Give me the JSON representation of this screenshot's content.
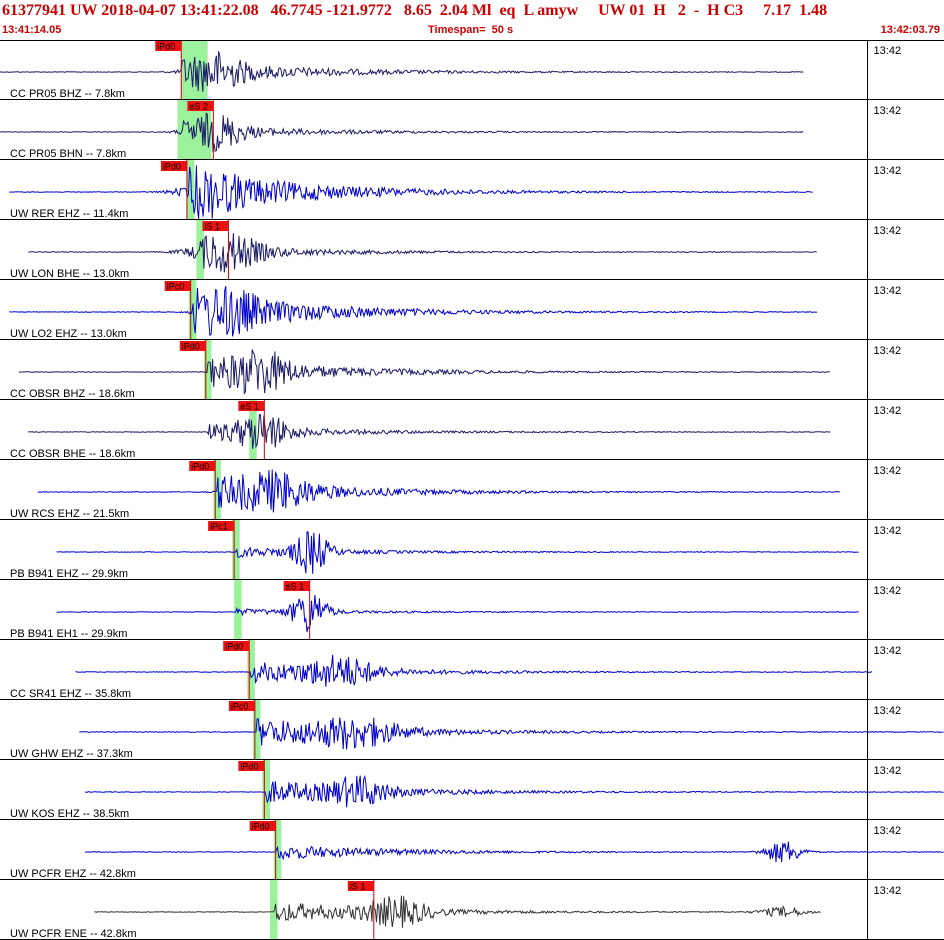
{
  "header": {
    "title": "61377941 UW 2018-04-07 13:41:22.08   46.7745 -121.9772   8.65  2.04 Ml  eq  L amyw     UW 01  H   2  -  H C3     7.17  1.48",
    "start_time": "13:41:14.05",
    "timespan": "Timespan=  50 s",
    "end_time": "13:42:03.79"
  },
  "chart_data": {
    "type": "line",
    "title": "61377941 UW 2018-04-07 13:41:22.08   46.7745 -121.9772   8.65  2.04 Ml  eq  L amyw     UW 01  H   2  -  H C3     7.17  1.48",
    "x_range_seconds": [
      0,
      50
    ],
    "minute_tick_label": "13:42",
    "minute_tick_seconds": 45.95,
    "traces": [
      {
        "label": "CC PR05 BHZ -- 7.8km",
        "color": "#1a1a66",
        "start": 0,
        "end": 42.6,
        "onset": 9.6,
        "amp": 0.48,
        "peaks": [
          [
            11.4,
            1.4,
            0.5
          ]
        ],
        "pick": "iPd0",
        "pick_t": 9.6,
        "green": [
          9.6,
          11.0
        ]
      },
      {
        "label": "CC PR05 BHN -- 7.8km",
        "color": "#1a1a66",
        "start": 0,
        "end": 42.6,
        "onset": 9.6,
        "amp": 0.3,
        "peaks": [
          [
            11.4,
            1.4,
            0.55
          ]
        ],
        "pick": "eS 2",
        "pick_t": 11.3,
        "green": [
          9.4,
          11.2
        ]
      },
      {
        "label": "UW RER EHZ -- 11.4km",
        "color": "#0000cc",
        "start": 0.5,
        "end": 43.1,
        "onset": 10.0,
        "amp": 0.9,
        "peaks": [
          [
            10.9,
            1.6,
            0.3
          ]
        ],
        "pick": "iPd0",
        "pick_t": 9.9,
        "green": [
          9.9,
          10.3
        ]
      },
      {
        "label": "UW LON BHE -- 13.0km",
        "color": "#1a1a66",
        "start": 1.5,
        "end": 43.3,
        "onset": 10.6,
        "amp": 0.28,
        "peaks": [
          [
            12.0,
            1.8,
            0.6
          ]
        ],
        "pick": "iS 1",
        "pick_t": 12.1,
        "green": [
          10.4,
          10.8
        ]
      },
      {
        "label": "UW LO2 EHZ -- 13.0km",
        "color": "#0000cc",
        "start": 0.5,
        "end": 43.3,
        "onset": 10.2,
        "amp": 0.85,
        "peaks": [
          [
            12.1,
            1.4,
            0.5
          ]
        ],
        "pick": "iPc0",
        "pick_t": 10.1,
        "green": [
          10.0,
          10.4
        ]
      },
      {
        "label": "CC OBSR BHZ -- 18.6km",
        "color": "#1a1a66",
        "start": 1.0,
        "end": 44.0,
        "onset": 11.0,
        "amp": 0.6,
        "peaks": [
          [
            13.8,
            1.4,
            0.6
          ]
        ],
        "pick": "iPd0",
        "pick_t": 10.9,
        "green": [
          10.8,
          11.2
        ]
      },
      {
        "label": "CC OBSR BHE -- 18.6km",
        "color": "#1a1a66",
        "start": 1.5,
        "end": 44.0,
        "onset": 11.0,
        "amp": 0.3,
        "peaks": [
          [
            13.9,
            1.4,
            0.6
          ]
        ],
        "pick": "eS 1",
        "pick_t": 14.0,
        "green": [
          13.2,
          13.6
        ]
      },
      {
        "label": "UW RCS EHZ -- 21.5km",
        "color": "#0000cc",
        "start": 2.0,
        "end": 44.5,
        "onset": 11.5,
        "amp": 0.6,
        "peaks": [
          [
            14.5,
            1.8,
            0.5
          ]
        ],
        "pick": "iPd0",
        "pick_t": 11.4,
        "green": [
          11.3,
          11.7
        ]
      },
      {
        "label": "PB B941 EHZ -- 29.9km",
        "color": "#0000cc",
        "start": 3.0,
        "end": 45.5,
        "onset": 12.5,
        "amp": 0.2,
        "peaks": [
          [
            16.5,
            0.9,
            0.8
          ]
        ],
        "pick": "iPc1",
        "pick_t": 12.4,
        "green": [
          12.3,
          12.7
        ]
      },
      {
        "label": "PB B941 EH1 -- 29.9km",
        "color": "#0000cc",
        "start": 3.0,
        "end": 45.5,
        "onset": 12.5,
        "amp": 0.12,
        "peaks": [
          [
            16.4,
            0.9,
            0.8
          ]
        ],
        "pick": "eS 1",
        "pick_t": 16.4,
        "green": [
          12.4,
          12.8
        ]
      },
      {
        "label": "CC SR41 EHZ -- 35.8km",
        "color": "#0000cc",
        "start": 4.0,
        "end": 46.2,
        "onset": 13.3,
        "amp": 0.4,
        "peaks": [
          [
            18.0,
            1.8,
            0.5
          ]
        ],
        "pick": "iPd0",
        "pick_t": 13.2,
        "green": [
          13.1,
          13.5
        ]
      },
      {
        "label": "UW GHW EHZ -- 37.3km",
        "color": "#0000cc",
        "start": 4.2,
        "end": 50,
        "onset": 13.6,
        "amp": 0.55,
        "peaks": [
          [
            18.8,
            2.2,
            0.45
          ]
        ],
        "pick": "iPc0",
        "pick_t": 13.5,
        "green": [
          13.4,
          13.8
        ]
      },
      {
        "label": "UW KOS EHZ -- 38.5km",
        "color": "#0000cc",
        "start": 4.5,
        "end": 50,
        "onset": 14.1,
        "amp": 0.45,
        "peaks": [
          [
            19.0,
            1.5,
            0.45
          ]
        ],
        "pick": "iPd0",
        "pick_t": 14.0,
        "green": [
          13.9,
          14.3
        ]
      },
      {
        "label": "UW PCFR EHZ -- 42.8km",
        "color": "#0000cc",
        "start": 4.5,
        "end": 50,
        "onset": 14.6,
        "amp": 0.3,
        "peaks": [
          [
            41.5,
            1.0,
            0.45
          ]
        ],
        "pick": "iPd0",
        "pick_t": 14.6,
        "green": [
          14.5,
          14.9
        ]
      },
      {
        "label": "UW PCFR ENE -- 42.8km",
        "color": "#333333",
        "start": 5.0,
        "end": 43.5,
        "onset": 14.5,
        "amp": 0.4,
        "peaks": [
          [
            21.0,
            1.6,
            0.5
          ],
          [
            41.5,
            1.2,
            0.2
          ]
        ],
        "pick": "iS 1",
        "pick_t": 19.8,
        "green": [
          14.3,
          14.7
        ]
      }
    ]
  }
}
